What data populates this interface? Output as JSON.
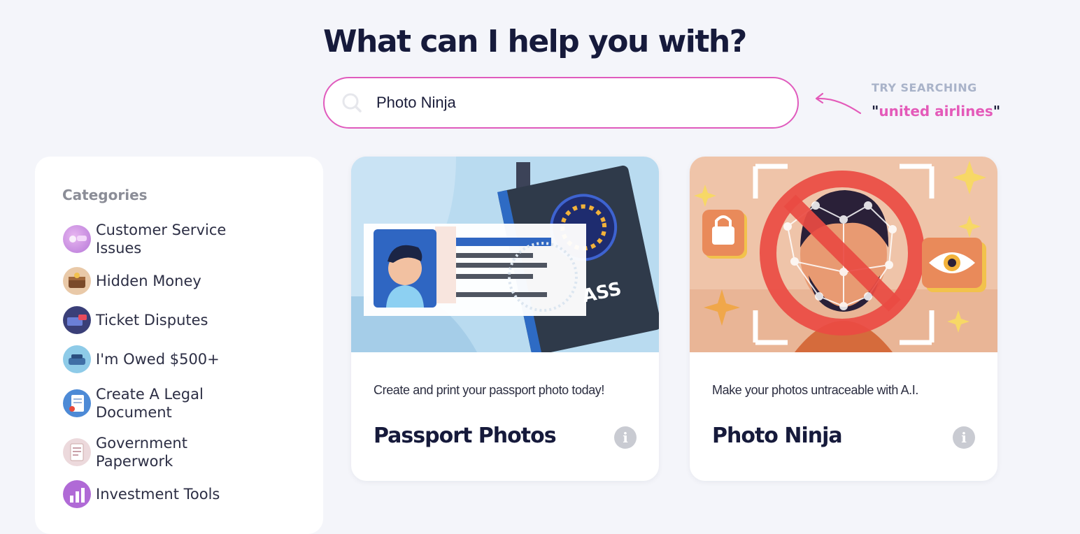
{
  "heading": "What can I help you with?",
  "search": {
    "value": "Photo Ninja"
  },
  "hint": {
    "label": "TRY SEARCHING",
    "quote_open": "\"",
    "example": "united airlines",
    "quote_close": "\""
  },
  "sidebar": {
    "heading": "Categories",
    "items": [
      {
        "label": "Customer Service Issues",
        "icon": "customer-service-icon"
      },
      {
        "label": "Hidden Money",
        "icon": "treasure-chest-icon"
      },
      {
        "label": "Ticket Disputes",
        "icon": "ticket-icon"
      },
      {
        "label": "I'm Owed $500+",
        "icon": "money-icon"
      },
      {
        "label": "Create A Legal Document",
        "icon": "legal-document-icon"
      },
      {
        "label": "Government Paperwork",
        "icon": "paperwork-icon"
      },
      {
        "label": "Investment Tools",
        "icon": "investment-icon"
      }
    ]
  },
  "cards": [
    {
      "description": "Create and print your passport photo today!",
      "title": "Passport Photos",
      "art_text": "ASS",
      "info_icon": "i"
    },
    {
      "description": "Make your photos untraceable with A.I.",
      "title": "Photo Ninja",
      "info_icon": "i"
    }
  ],
  "colors": {
    "accent_pink": "#e45ab9",
    "background": "#f4f5fa",
    "heading": "#161a3b"
  }
}
